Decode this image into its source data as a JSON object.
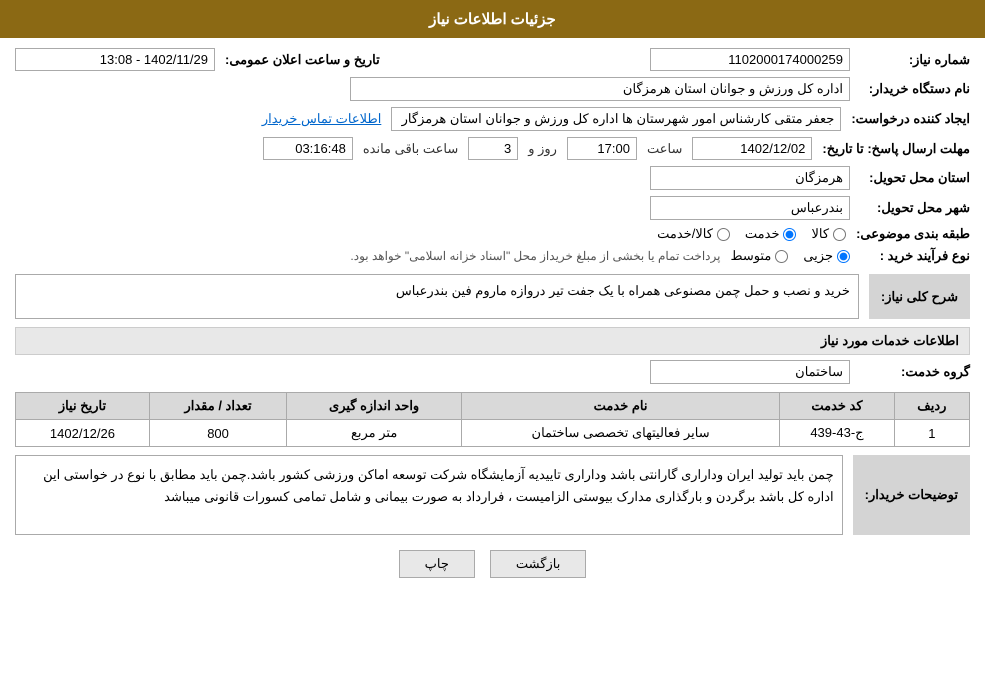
{
  "header": {
    "title": "جزئیات اطلاعات نیاز"
  },
  "fields": {
    "shomareNiaz_label": "شماره نیاز:",
    "shomareNiaz_value": "1102000174000259",
    "namDasgah_label": "نام دستگاه خریدار:",
    "namDasgah_value": "اداره کل ورزش و جوانان استان هرمزگان",
    "ijadKonande_label": "ایجاد کننده درخواست:",
    "ijadKonande_value": "جعفر متقی کارشناس امور شهرستان ها اداره کل ورزش و جوانان استان هرمزگار",
    "etelaatTamas_label": "اطلاعات تماس خریدار",
    "mohlat_label": "مهلت ارسال پاسخ: تا تاریخ:",
    "date_value": "1402/12/02",
    "saat_label": "ساعت",
    "saat_value": "17:00",
    "rooz_label": "روز و",
    "rooz_value": "3",
    "baghimande_label": "ساعت باقی مانده",
    "baghimande_value": "03:16:48",
    "tarikh_elan_label": "تاریخ و ساعت اعلان عمومی:",
    "tarikh_elan_value": "1402/11/29 - 13:08",
    "ostan_label": "استان محل تحویل:",
    "ostan_value": "هرمزگان",
    "shahr_label": "شهر محل تحویل:",
    "shahr_value": "بندرعباس",
    "tabaqe_label": "طبقه بندی موضوعی:",
    "kala_option": "کالا",
    "khedmat_option": "خدمت",
    "kala_khedmat_option": "کالا/خدمت",
    "noe_farayand_label": "نوع فرآیند خرید :",
    "jezvi_option": "جزیی",
    "motavasset_option": "متوسط",
    "farayand_note": "پرداخت تمام یا بخشی از مبلغ خریداز محل \"اسناد خزانه اسلامی\" خواهد بود.",
    "sharh_label": "شرح کلی نیاز:",
    "sharh_value": "خرید و نصب و حمل چمن مصنوعی همراه با یک جفت تیر دروازه ماروم فین بندرعباس",
    "khadamat_label": "اطلاعات خدمات مورد نیاز",
    "gorohe_khedmat_label": "گروه خدمت:",
    "gorohe_khedmat_value": "ساختمان",
    "table_headers": [
      "ردیف",
      "کد خدمت",
      "نام خدمت",
      "واحد اندازه گیری",
      "تعداد / مقدار",
      "تاریخ نیاز"
    ],
    "table_rows": [
      {
        "radif": "1",
        "kod_khedmat": "ج-43-439",
        "nam_khedmat": "سایر فعالیتهای تخصصی ساختمان",
        "vahed": "متر مربع",
        "tedad": "800",
        "tarikh": "1402/12/26"
      }
    ],
    "tosih_label": "توضیحات خریدار:",
    "tosih_value": "چمن باید تولید ایران وداراری گارانتی باشد وداراری تاییدیه آزمایشگاه شرکت توسعه اماکن ورزشی کشور باشد.چمن باید مطابق با نوع در خواستی این اداره کل باشد برگردن و بارگذاری مدارک بیوستی الزامیست   ،  فرارداد به صورت بیمانی و شامل تمامی کسورات قانونی میباشد",
    "print_btn": "چاپ",
    "back_btn": "بازگشت"
  }
}
